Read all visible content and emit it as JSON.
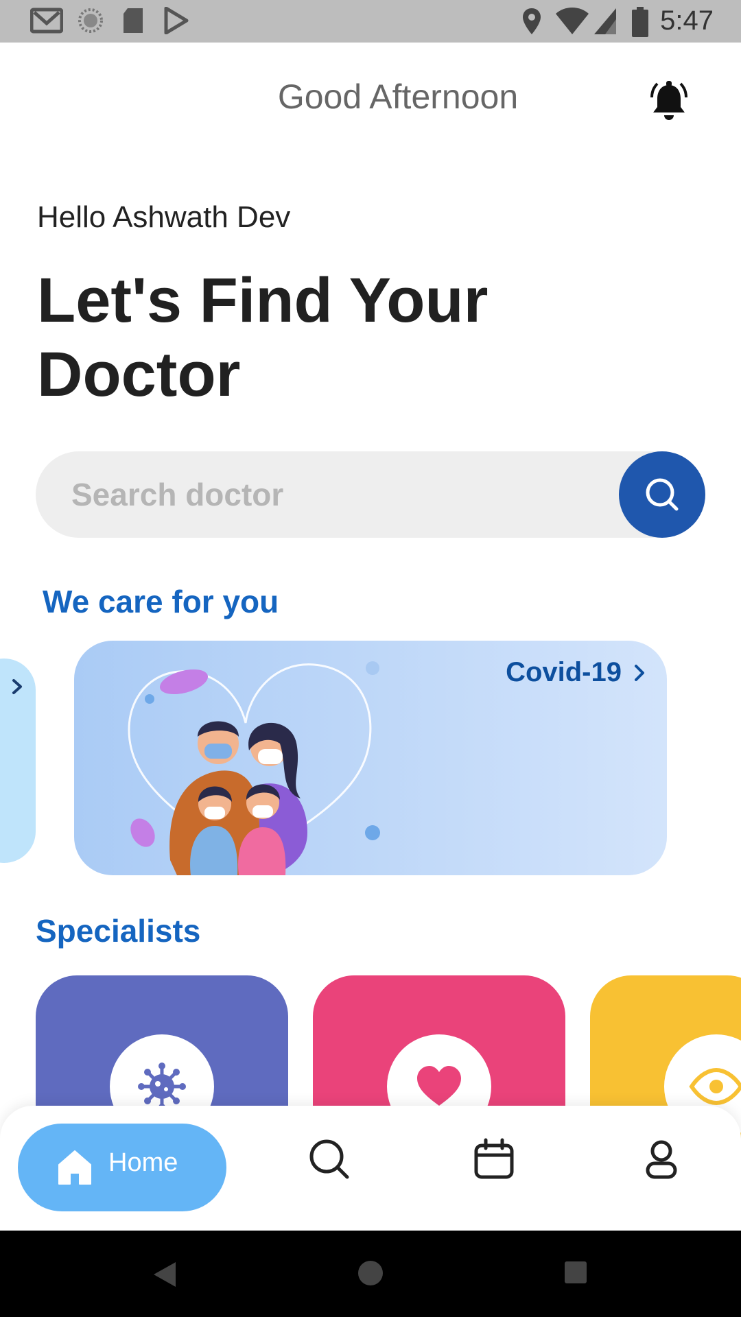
{
  "status_bar": {
    "time": "5:47",
    "icons": [
      "gmail-icon",
      "sync-icon",
      "sd-card-icon",
      "play-store-icon",
      "location-icon",
      "wifi-icon",
      "signal-icon",
      "battery-icon"
    ]
  },
  "header": {
    "greeting": "Good Afternoon",
    "bell_icon": "notification-bell-icon"
  },
  "user": {
    "hello": "Hello Ashwath Dev"
  },
  "headline": "Let's Find Your Doctor",
  "search": {
    "placeholder": "Search doctor",
    "value": "",
    "button_icon": "search-icon"
  },
  "care_section": {
    "title": "We care for you",
    "cards": [
      {
        "label": "Covid-19",
        "icon": "chevron-right-icon",
        "image": "family-with-masks-illustration"
      }
    ]
  },
  "specialists": {
    "title": "Specialists",
    "items": [
      {
        "icon": "virus-icon",
        "color": "#5f6bbf"
      },
      {
        "icon": "heart-icon",
        "color": "#ea437a"
      },
      {
        "icon": "eye-icon",
        "color": "#f8c133"
      }
    ]
  },
  "bottom_nav": {
    "items": [
      {
        "label": "Home",
        "icon": "home-icon",
        "active": true
      },
      {
        "label": "",
        "icon": "search-icon"
      },
      {
        "label": "",
        "icon": "calendar-icon"
      },
      {
        "label": "",
        "icon": "profile-icon"
      }
    ]
  },
  "system_nav": [
    "back-icon",
    "home-circle-icon",
    "recents-icon"
  ],
  "colors": {
    "primary": "#1f57ad",
    "section_title": "#1565c0",
    "nav_active": "#64b5f6"
  }
}
